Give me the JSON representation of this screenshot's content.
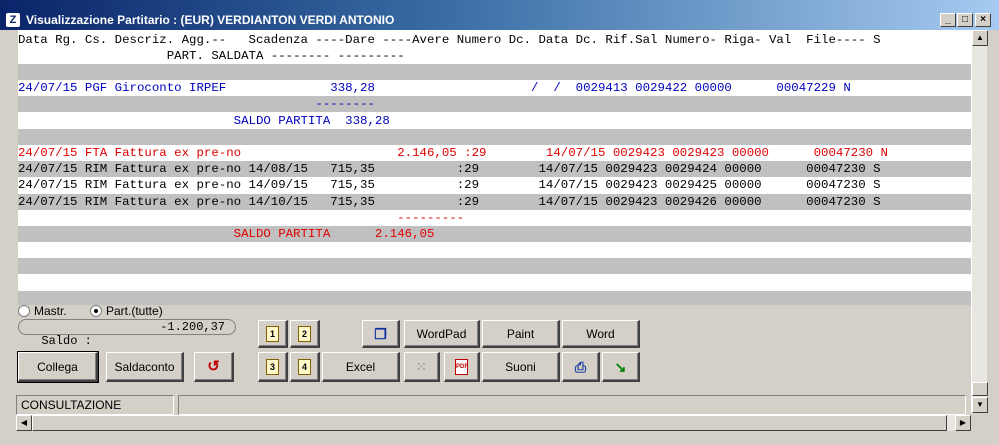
{
  "window": {
    "title": "Visualizzazione Partitario : (EUR) VERDIANTON VERDI ANTONIO",
    "min_glyph": "_",
    "max_glyph": "□",
    "close_glyph": "×"
  },
  "grid": {
    "header1": "Data Rg. Cs. Descriz. Agg.--   Scadenza ----Dare ----Avere Numero Dc. Data Dc. Rif.Sal Numero- Riga- Val  File---- S",
    "header2": "                    PART. SALDATA -------- ---------",
    "rows": [
      {
        "text": "",
        "style": "gray"
      },
      {
        "text": "24/07/15 PGF Giroconto IRPEF              338,28                     /  /  0029413 0029422 00000      00047229 N",
        "style": "blue"
      },
      {
        "text": "                                        --------",
        "style": "gray blue"
      },
      {
        "text": "                             SALDO PARTITA  338,28",
        "style": "blue"
      },
      {
        "text": "",
        "style": "gray"
      },
      {
        "text": "24/07/15 FTA Fattura ex pre-no                     2.146,05 :29        14/07/15 0029423 0029423 00000      00047230 N",
        "style": "red"
      },
      {
        "text": "24/07/15 RIM Fattura ex pre-no 14/08/15   715,35           :29        14/07/15 0029423 0029424 00000      00047230 S",
        "style": "gray black"
      },
      {
        "text": "24/07/15 RIM Fattura ex pre-no 14/09/15   715,35           :29        14/07/15 0029423 0029425 00000      00047230 S",
        "style": "black"
      },
      {
        "text": "24/07/15 RIM Fattura ex pre-no 14/10/15   715,35           :29        14/07/15 0029423 0029426 00000      00047230 S",
        "style": "gray black"
      },
      {
        "text": "                                                   ---------",
        "style": "red"
      },
      {
        "text": "                             SALDO PARTITA      2.146,05",
        "style": "gray red"
      },
      {
        "text": "",
        "style": ""
      },
      {
        "text": "",
        "style": "gray"
      },
      {
        "text": "",
        "style": ""
      },
      {
        "text": "",
        "style": "gray"
      }
    ]
  },
  "options": {
    "mastr_label": "Mastr.",
    "part_label": "Part.(tutte)"
  },
  "saldo": {
    "label": "Saldo :",
    "value": "-1.200,37"
  },
  "buttons": {
    "collega": "Collega",
    "saldaconto": "Saldaconto",
    "excel": "Excel",
    "wordpad": "WordPad",
    "paint": "Paint",
    "word": "Word",
    "suoni": "Suoni",
    "page1": "1",
    "page2": "2",
    "page3": "3",
    "page4": "4",
    "pdf_glyph": "PDF"
  },
  "status": {
    "mode": "CONSULTAZIONE",
    "message": ""
  },
  "colors": {
    "blue_text": "#0000c0",
    "red_text": "#e00000",
    "row_gray": "#c0c0c0"
  }
}
